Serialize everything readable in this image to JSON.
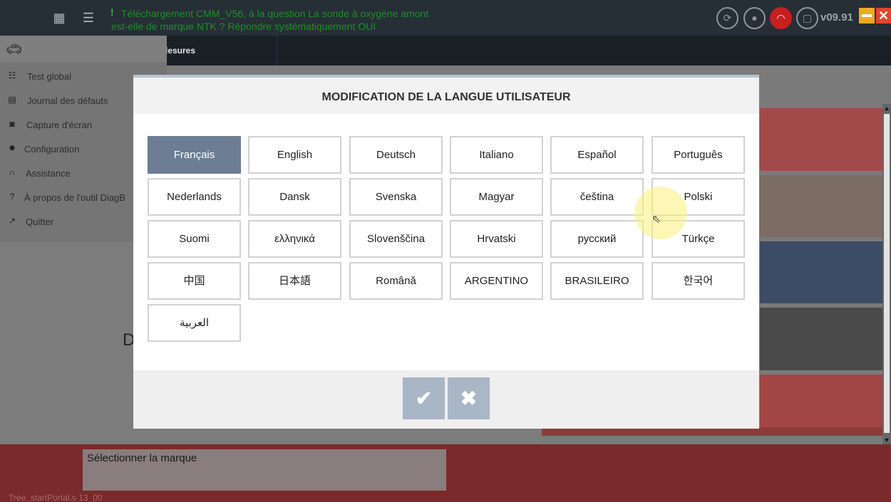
{
  "topbar": {
    "message_line1": "Téléchargement CMM_V56, à la question La sonde à oxygène amont",
    "message_line2": "est-elle de marque NTK ? Répondre systématiquement OUI",
    "version": "v09.91"
  },
  "navbar": {
    "tab_label": "lesures"
  },
  "sidemenu": {
    "items": [
      {
        "label": "Test global",
        "icon": "test-icon"
      },
      {
        "label": "Journal des défauts",
        "icon": "log-icon"
      },
      {
        "label": "Capture d'écran",
        "icon": "camera-icon"
      },
      {
        "label": "Configuration",
        "icon": "gear-icon"
      },
      {
        "label": "Assistance",
        "icon": "headset-icon"
      },
      {
        "label": "À propos de l'outil DiagB",
        "icon": "help-icon"
      },
      {
        "label": "Quitter",
        "icon": "exit-icon"
      }
    ]
  },
  "main": {
    "partial_letter": "D"
  },
  "modal": {
    "title": "MODIFICATION DE LA LANGUE UTILISATEUR",
    "selected": "Français",
    "languages": [
      "Français",
      "English",
      "Deutsch",
      "Italiano",
      "Español",
      "Português",
      "Nederlands",
      "Dansk",
      "Svenska",
      "Magyar",
      "čeština",
      "Polski",
      "Suomi",
      "ελληνικά",
      "Slovenščina",
      "Hrvatski",
      "русский",
      "Türkçe",
      "中国",
      "日本語",
      "Română",
      "ARGENTINO",
      "BRASILEIRO",
      "한국어",
      "العربية"
    ]
  },
  "bottom": {
    "brand_label": "Sélectionner la marque",
    "status": "Tree_startPortal.s   13_00"
  },
  "colors": {
    "selected_lang": "#6c7d94",
    "action_button": "#a9b6c5",
    "top_bar": "#262e36",
    "bottom_bar": "#7a2a2a",
    "panel_1": "#a24a4a",
    "panel_2": "#7b6d63",
    "panel_3": "#3b4c64",
    "panel_4": "#4a4a4a",
    "panel_5": "#a24545"
  }
}
